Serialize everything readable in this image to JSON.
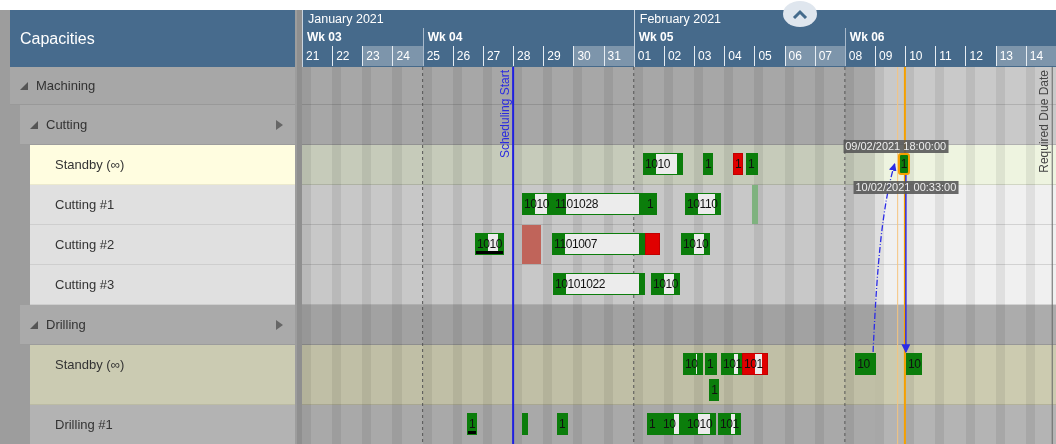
{
  "panel": {
    "title": "Capacities"
  },
  "timeline": {
    "months": [
      {
        "label": "January 2021",
        "weeks": [
          {
            "label": "Wk 03",
            "days": [
              {
                "label": "21",
                "weekend": false
              },
              {
                "label": "22",
                "weekend": false
              },
              {
                "label": "23",
                "weekend": true
              },
              {
                "label": "24",
                "weekend": true
              }
            ]
          },
          {
            "label": "Wk 04",
            "days": [
              {
                "label": "25",
                "weekend": false
              },
              {
                "label": "26",
                "weekend": false
              },
              {
                "label": "27",
                "weekend": false
              },
              {
                "label": "28",
                "weekend": false
              },
              {
                "label": "29",
                "weekend": false
              },
              {
                "label": "30",
                "weekend": true
              },
              {
                "label": "31",
                "weekend": true
              }
            ]
          }
        ]
      },
      {
        "label": "February 2021",
        "weeks": [
          {
            "label": "Wk 05",
            "days": [
              {
                "label": "01",
                "weekend": false
              },
              {
                "label": "02",
                "weekend": false
              },
              {
                "label": "03",
                "weekend": false
              },
              {
                "label": "04",
                "weekend": false
              },
              {
                "label": "05",
                "weekend": false
              },
              {
                "label": "06",
                "weekend": true
              },
              {
                "label": "07",
                "weekend": true
              }
            ]
          },
          {
            "label": "Wk 06",
            "days": [
              {
                "label": "08",
                "weekend": false
              },
              {
                "label": "09",
                "weekend": false
              },
              {
                "label": "10",
                "weekend": false
              },
              {
                "label": "11",
                "weekend": false
              },
              {
                "label": "12",
                "weekend": false
              },
              {
                "label": "13",
                "weekend": true
              },
              {
                "label": "14",
                "weekend": true
              }
            ]
          }
        ]
      }
    ],
    "lines": [
      {
        "kind": "scheduling-start",
        "label": "Scheduling Start"
      },
      {
        "kind": "due",
        "label": "Required Due Date"
      }
    ]
  },
  "tree": [
    {
      "label": "Machining",
      "expanded": true,
      "children": [
        {
          "label": "Cutting",
          "expanded": true,
          "active": true,
          "children": [
            {
              "label": "Standby (∞)",
              "kind": "standby",
              "lanes": [
                [
                  {
                    "label": "1010",
                    "kind": "split",
                    "selected": false,
                    "flagged": false
                  },
                  {
                    "label": "1",
                    "kind": "solid",
                    "selected": false,
                    "flagged": false
                  },
                  {
                    "label": "1",
                    "kind": "late",
                    "selected": false,
                    "flagged": false
                  },
                  {
                    "label": "1",
                    "kind": "solid",
                    "selected": false,
                    "flagged": false
                  },
                  {
                    "label": "1",
                    "kind": "solid",
                    "selected": true,
                    "flagged": false,
                    "start_label": "09/02/2021 18:00:00",
                    "end_label": "10/02/2021 00:33:00"
                  }
                ]
              ]
            },
            {
              "label": "Cutting #1",
              "kind": "machine",
              "lanes": [
                [
                  {
                    "label": "1010",
                    "kind": "split",
                    "selected": false,
                    "flagged": false
                  },
                  {
                    "label": "1101028",
                    "kind": "split",
                    "selected": false,
                    "flagged": false
                  },
                  {
                    "label": "1",
                    "kind": "solid",
                    "selected": false,
                    "flagged": false
                  },
                  {
                    "label": "10110",
                    "kind": "split",
                    "selected": false,
                    "flagged": false
                  },
                  {
                    "kind": "pale",
                    "selected": false,
                    "flagged": false
                  }
                ]
              ]
            },
            {
              "label": "Cutting #2",
              "kind": "machine",
              "lanes": [
                [
                  {
                    "label": "1010",
                    "kind": "split",
                    "selected": false,
                    "flagged": true
                  },
                  {
                    "kind": "blocked",
                    "selected": false,
                    "flagged": false
                  },
                  {
                    "label": "1101007",
                    "kind": "split",
                    "selected": false,
                    "flagged": false
                  },
                  {
                    "kind": "late",
                    "selected": false,
                    "flagged": false
                  },
                  {
                    "label": "1010",
                    "kind": "split",
                    "selected": false,
                    "flagged": false
                  }
                ]
              ]
            },
            {
              "label": "Cutting #3",
              "kind": "machine",
              "lanes": [
                [
                  {
                    "label": "10101022",
                    "kind": "split",
                    "selected": false,
                    "flagged": false
                  },
                  {
                    "label": "1010",
                    "kind": "split",
                    "selected": false,
                    "flagged": false
                  }
                ]
              ]
            }
          ]
        },
        {
          "label": "Drilling",
          "expanded": true,
          "active": false,
          "children": [
            {
              "label": "Standby (∞)",
              "kind": "standby",
              "lanes": [
                [
                  {
                    "label": "10",
                    "kind": "split",
                    "selected": false,
                    "flagged": false
                  },
                  {
                    "label": "1",
                    "kind": "solid",
                    "selected": false,
                    "flagged": false
                  },
                  {
                    "label": "101",
                    "kind": "split",
                    "selected": false,
                    "flagged": false
                  },
                  {
                    "label": "101",
                    "kind": "late-split",
                    "selected": false,
                    "flagged": false
                  },
                  {
                    "label": "10",
                    "kind": "solid",
                    "selected": false,
                    "flagged": false
                  },
                  {
                    "label": "10",
                    "kind": "split",
                    "selected": false,
                    "flagged": false
                  }
                ],
                [
                  {
                    "label": "1",
                    "kind": "solid",
                    "selected": false,
                    "flagged": false
                  }
                ]
              ]
            },
            {
              "label": "Drilling #1",
              "kind": "machine",
              "lanes": [
                [
                  {
                    "label": "1",
                    "kind": "solid",
                    "selected": false,
                    "flagged": true
                  },
                  {
                    "kind": "solid",
                    "selected": false,
                    "flagged": false
                  },
                  {
                    "label": "1",
                    "kind": "solid",
                    "selected": false,
                    "flagged": false
                  },
                  {
                    "label": "1",
                    "kind": "solid",
                    "selected": false,
                    "flagged": false
                  },
                  {
                    "label": "10",
                    "kind": "split",
                    "selected": false,
                    "flagged": false
                  },
                  {
                    "label": "1010",
                    "kind": "split",
                    "selected": false,
                    "flagged": false
                  },
                  {
                    "label": "101",
                    "kind": "split",
                    "selected": false,
                    "flagged": false
                  }
                ]
              ]
            }
          ]
        }
      ]
    }
  ]
}
